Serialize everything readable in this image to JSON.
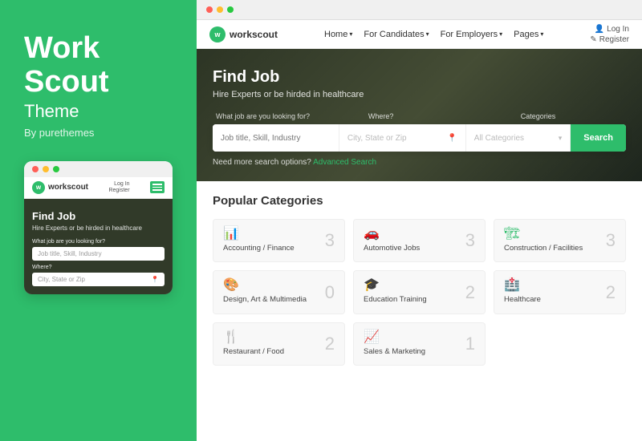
{
  "left": {
    "title_line1": "Work",
    "title_line2": "Scout",
    "subtitle": "Theme",
    "by": "By purethemes",
    "mobile": {
      "logo": "workscout",
      "nav_login": "Log In",
      "nav_register": "Register",
      "hero_title": "Find Job",
      "hero_subtitle": "Hire Experts or be hirded in healthcare",
      "search_label": "What job are you looking for?",
      "search_placeholder": "Job title, Skill, Industry",
      "where_label": "Where?",
      "where_placeholder": "City, State or Zip"
    }
  },
  "browser": {
    "dots": [
      "red",
      "yellow",
      "green"
    ]
  },
  "site": {
    "logo": "workscout",
    "nav_links": [
      {
        "label": "Home",
        "has_arrow": true
      },
      {
        "label": "For Candidates",
        "has_arrow": true
      },
      {
        "label": "For Employers",
        "has_arrow": true
      },
      {
        "label": "Pages",
        "has_arrow": true
      }
    ],
    "nav_right": {
      "login": "Log In",
      "register": "Register"
    },
    "hero": {
      "title": "Find Job",
      "subtitle": "Hire Experts or be hirded in healthcare",
      "label_job": "What job are you looking for?",
      "label_where": "Where?",
      "label_categories": "Categories",
      "search_placeholder": "Job title, Skill, Industry",
      "location_placeholder": "City, State or Zip",
      "category_placeholder": "All Categories",
      "search_btn": "Search",
      "advanced_text": "Need more search options?",
      "advanced_link": "Advanced Search"
    },
    "categories": {
      "section_title": "Popular Categories",
      "items": [
        {
          "icon": "📊",
          "name": "Accounting /\nFinance",
          "count": "3"
        },
        {
          "icon": "🚗",
          "name": "Automotive Jobs",
          "count": "3"
        },
        {
          "icon": "🏗",
          "name": "Construction /\nFacilities",
          "count": "3"
        },
        {
          "icon": "🎨",
          "name": "Design, Art &\nMultimedia",
          "count": "0"
        },
        {
          "icon": "🎓",
          "name": "Education Training",
          "count": "2"
        },
        {
          "icon": "🏥",
          "name": "Healthcare",
          "count": "2"
        },
        {
          "icon": "🍴",
          "name": "Restaurant / Food",
          "count": "2"
        },
        {
          "icon": "📈",
          "name": "Sales & Marketing",
          "count": "1"
        }
      ]
    }
  }
}
